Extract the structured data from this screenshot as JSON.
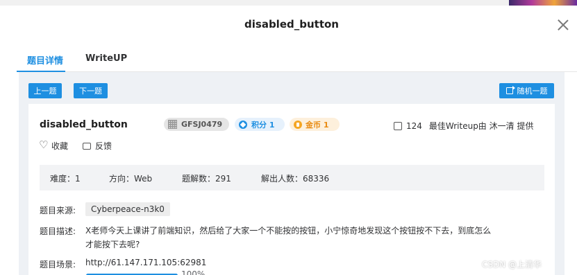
{
  "modal": {
    "title": "disabled_button"
  },
  "tabs": [
    {
      "label": "题目详情",
      "active": true
    },
    {
      "label": "WriteUP",
      "active": false
    }
  ],
  "nav": {
    "prev_label": "上一题",
    "next_label": "下一题",
    "random_label": "随机一题"
  },
  "challenge": {
    "name": "disabled_button",
    "id_badge": "GFSJ0479",
    "score_badge": "积分 1",
    "coin_badge": "金币 1",
    "likes": "124",
    "best_writeup": "最佳Writeup由 沐一清 提供",
    "favorite_label": "收藏",
    "feedback_label": "反馈"
  },
  "stats": {
    "difficulty": "难度：1",
    "direction": "方向：Web",
    "solves": "题解数：291",
    "solvers": "解出人数：68336"
  },
  "details": {
    "source_label": "题目来源:",
    "source_value": "Cyberpeace-n3k0",
    "desc_label": "题目描述:",
    "desc_line1": "X老师今天上课讲了前端知识，然后给了大家一个不能按的按钮，小宁惊奇地发现这个按钮按不下去，到底怎么",
    "desc_line2": "才能按下去呢?",
    "scene_label": "题目场景:",
    "scene_url": "http://61.147.171.105:62981",
    "progress_percent": 100,
    "progress_text": "100%"
  },
  "watermark": "CSDN @上清华",
  "colors": {
    "accent": "#1e8fe1",
    "coin": "#f5a623",
    "panel_bg": "#eef1f5"
  }
}
